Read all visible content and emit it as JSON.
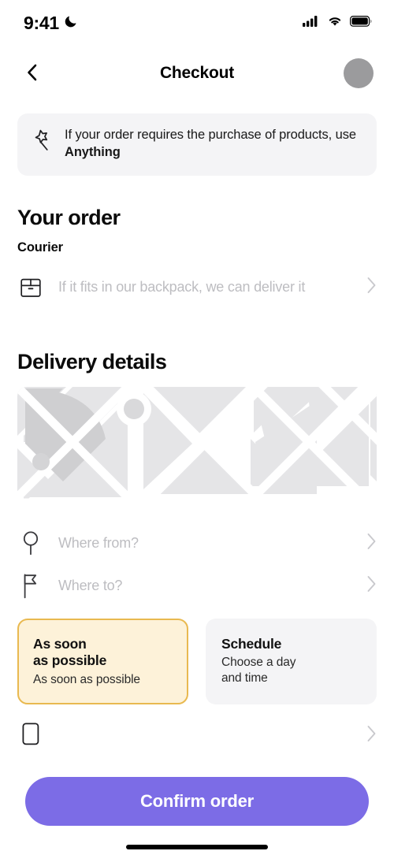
{
  "status_bar": {
    "time": "9:41",
    "dnd_icon": "crescent-moon-icon",
    "signal_icon": "cellular-signal-icon",
    "wifi_icon": "wifi-icon",
    "battery_icon": "battery-full-icon"
  },
  "header": {
    "back_icon": "chevron-left-icon",
    "title": "Checkout",
    "avatar": "user-avatar"
  },
  "banner": {
    "icon": "magic-wand-icon",
    "text_before": "If your order requires the purchase of products, use ",
    "text_bold": "Anything"
  },
  "order": {
    "section_title": "Your order",
    "sub_title": "Courier",
    "item": {
      "icon": "package-box-icon",
      "placeholder": "If it fits in our backpack, we can deliver it",
      "chevron": "chevron-right-icon"
    }
  },
  "delivery": {
    "section_title": "Delivery details",
    "map": "map-preview",
    "from": {
      "icon": "origin-pin-icon",
      "placeholder": "Where from?",
      "chevron": "chevron-right-icon"
    },
    "to": {
      "icon": "destination-flag-icon",
      "placeholder": "Where to?",
      "chevron": "chevron-right-icon"
    },
    "timing_options": [
      {
        "title_line1": "As soon",
        "title_line2": "as possible",
        "subtitle": "As soon as possible",
        "selected": true
      },
      {
        "title_line1": "Schedule",
        "title_line2": "",
        "subtitle_line1": "Choose a day",
        "subtitle_line2": "and time",
        "selected": false
      }
    ],
    "extra_row": {
      "icon": "note-card-icon",
      "placeholder": "",
      "chevron": "chevron-right-icon"
    }
  },
  "cta": {
    "label": "Confirm order"
  },
  "colors": {
    "accent_purple": "#7c6ce6",
    "selected_card_bg": "#fdf2d9",
    "selected_card_border": "#e9b950",
    "muted_bg": "#f4f4f6",
    "placeholder_text": "#bdbdc1",
    "avatar_gray": "#9b9b9d",
    "map_block": "#e5e5e7",
    "map_block_dark": "#cfcfd1"
  }
}
